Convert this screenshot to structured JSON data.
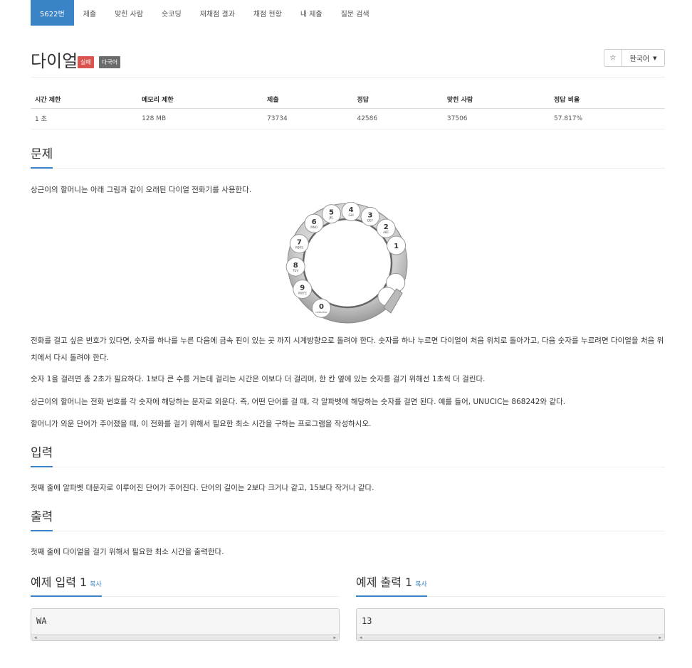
{
  "nav": {
    "tabs": [
      {
        "label": "5622번",
        "active": true
      },
      {
        "label": "제출"
      },
      {
        "label": "맞힌 사람"
      },
      {
        "label": "숏코딩"
      },
      {
        "label": "재채점 결과"
      },
      {
        "label": "채점 현황"
      },
      {
        "label": "내 제출"
      },
      {
        "label": "질문 검색"
      }
    ]
  },
  "problem": {
    "title": "다이얼",
    "badges": [
      "실패",
      "다국어"
    ],
    "star": "☆",
    "language": "한국어"
  },
  "info": {
    "headers": [
      "시간 제한",
      "메모리 제한",
      "제출",
      "정답",
      "맞힌 사람",
      "정답 비율"
    ],
    "values": [
      "1 초",
      "128 MB",
      "73734",
      "42586",
      "37506",
      "57.817%"
    ]
  },
  "sections": {
    "problem_title": "문제",
    "problem_intro": "상근이의 할머니는 아래 그림과 같이 오래된 다이얼 전화기를 사용한다.",
    "problem_p1": "전화를 걸고 싶은 번호가 있다면, 숫자를 하나를 누른 다음에 금속 핀이 있는 곳 까지 시계방향으로 돌려야 한다. 숫자를 하나 누르면 다이얼이 처음 위치로 돌아가고, 다음 숫자를 누르려면 다이얼을 처음 위치에서 다시 돌려야 한다.",
    "problem_p2": "숫자 1을 걸려면 총 2초가 필요하다. 1보다 큰 수를 거는데 걸리는 시간은 이보다 더 걸리며, 한 칸 옆에 있는 숫자를 걸기 위해선 1초씩 더 걸린다.",
    "problem_p3": "상근이의 할머니는 전화 번호를 각 숫자에 해당하는 문자로 외운다. 즉, 어떤 단어를 걸 때, 각 알파벳에 해당하는 숫자를 걸면 된다. 예를 들어, UNUCIC는 868242와 같다.",
    "problem_p4": "할머니가 외운 단어가 주어졌을 때, 이 전화를 걸기 위해서 필요한 최소 시간을 구하는 프로그램을 작성하시오.",
    "input_title": "입력",
    "input_text": "첫째 줄에 알파벳 대문자로 이루어진 단어가 주어진다. 단어의 길이는 2보다 크거나 같고, 15보다 작거나 같다.",
    "output_title": "출력",
    "output_text": "첫째 줄에 다이얼을 걸기 위해서 필요한 최소 시간을 출력한다."
  },
  "dial": {
    "holes": [
      {
        "num": "1",
        "letters": ""
      },
      {
        "num": "2",
        "letters": "ABC"
      },
      {
        "num": "3",
        "letters": "DEF"
      },
      {
        "num": "4",
        "letters": "GHI"
      },
      {
        "num": "5",
        "letters": "JKL"
      },
      {
        "num": "6",
        "letters": "MNO"
      },
      {
        "num": "7",
        "letters": "PQRS"
      },
      {
        "num": "8",
        "letters": "TUV"
      },
      {
        "num": "9",
        "letters": "WXYZ"
      },
      {
        "num": "0",
        "letters": "OPERATOR"
      }
    ]
  },
  "samples": {
    "input_title": "예제 입력 1",
    "output_title": "예제 출력 1",
    "copy_label": "복사",
    "input_value": "WA",
    "output_value": "13"
  },
  "colors": {
    "accent": "#3a83c6",
    "badge_fail": "#d9534f",
    "badge_multi": "#6c6c6c"
  }
}
